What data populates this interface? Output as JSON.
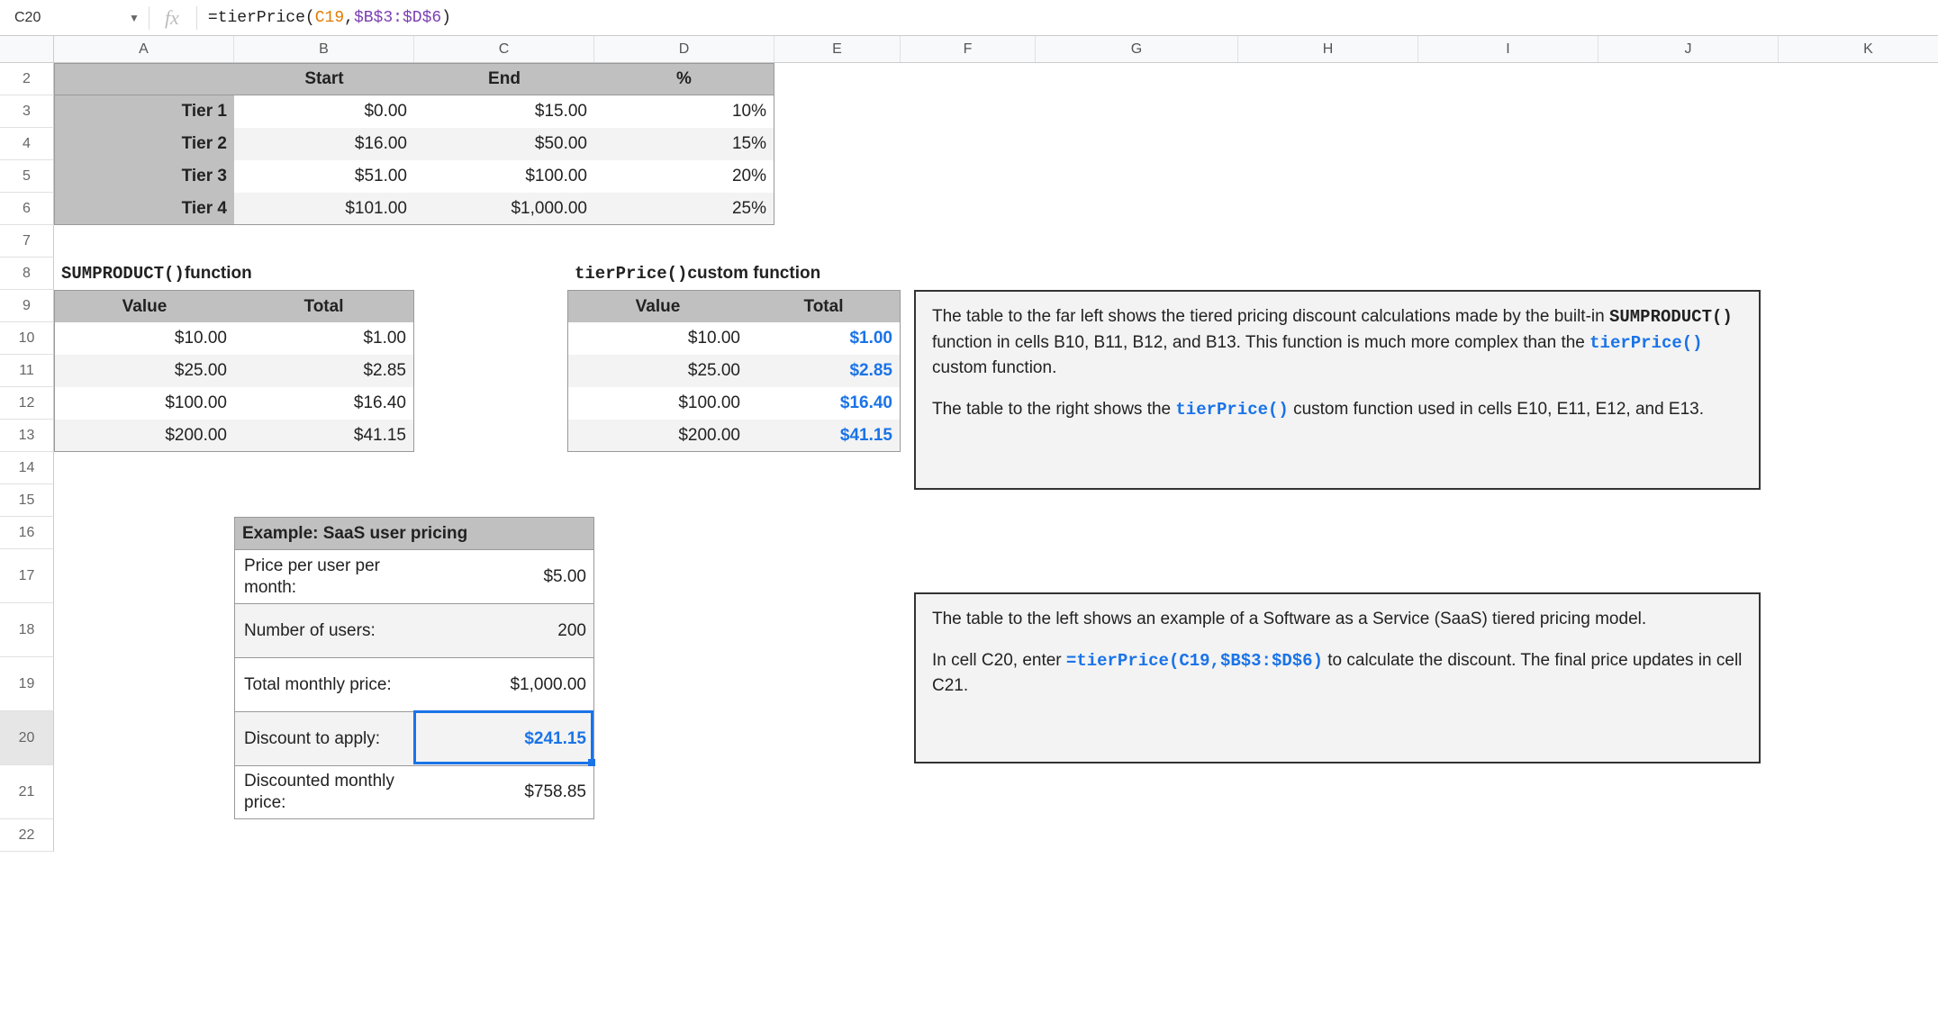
{
  "formula_bar": {
    "cell_ref": "C20",
    "fn": "=tierPrice",
    "arg1": "C19",
    "arg2": "$B$3:$D$6"
  },
  "columns": {
    "A": "A",
    "B": "B",
    "C": "C",
    "D": "D",
    "E": "E",
    "F": "F",
    "G": "G",
    "H": "H",
    "I": "I",
    "J": "J",
    "K": "K"
  },
  "rows": [
    "2",
    "3",
    "4",
    "5",
    "6",
    "7",
    "8",
    "9",
    "10",
    "11",
    "12",
    "13",
    "14",
    "15",
    "16",
    "17",
    "18",
    "19",
    "20",
    "21",
    "22"
  ],
  "tier_table": {
    "headers": {
      "start": "Start",
      "end": "End",
      "pct": "%"
    },
    "rows": [
      {
        "name": "Tier 1",
        "start": "$0.00",
        "end": "$15.00",
        "pct": "10%"
      },
      {
        "name": "Tier 2",
        "start": "$16.00",
        "end": "$50.00",
        "pct": "15%"
      },
      {
        "name": "Tier 3",
        "start": "$51.00",
        "end": "$100.00",
        "pct": "20%"
      },
      {
        "name": "Tier 4",
        "start": "$101.00",
        "end": "$1,000.00",
        "pct": "25%"
      }
    ]
  },
  "sumproduct": {
    "title_code": "SUMPRODUCT()",
    "title_rest": " function",
    "hdr_value": "Value",
    "hdr_total": "Total",
    "rows": [
      {
        "value": "$10.00",
        "total": "$1.00"
      },
      {
        "value": "$25.00",
        "total": "$2.85"
      },
      {
        "value": "$100.00",
        "total": "$16.40"
      },
      {
        "value": "$200.00",
        "total": "$41.15"
      }
    ]
  },
  "tierprice": {
    "title_code": "tierPrice()",
    "title_rest": " custom function",
    "hdr_value": "Value",
    "hdr_total": "Total",
    "rows": [
      {
        "value": "$10.00",
        "total": "$1.00"
      },
      {
        "value": "$25.00",
        "total": "$2.85"
      },
      {
        "value": "$100.00",
        "total": "$16.40"
      },
      {
        "value": "$200.00",
        "total": "$41.15"
      }
    ]
  },
  "saas": {
    "title": "Example: SaaS user pricing",
    "rows": [
      {
        "label": "Price per user per month:",
        "value": "$5.00"
      },
      {
        "label": "Number of users:",
        "value": "200"
      },
      {
        "label": "Total monthly price:",
        "value": "$1,000.00"
      },
      {
        "label": "Discount to apply:",
        "value": "$241.15"
      },
      {
        "label": "Discounted monthly price:",
        "value": "$758.85"
      }
    ]
  },
  "note1": {
    "p1a": "The table to the far left shows the tiered pricing discount calculations made by the built-in ",
    "p1code": "SUMPRODUCT()",
    "p1b": " function in cells B10, B11, B12, and B13. This function is much more complex than the ",
    "p1code2": "tierPrice()",
    "p1c": " custom function.",
    "p2a": "The table to the right shows the ",
    "p2code": "tierPrice()",
    "p2b": " custom function used in cells E10, E11, E12, and E13."
  },
  "note2": {
    "p1": "The table to the left shows an example of a Software as a Service (SaaS) tiered pricing model.",
    "p2a": "In cell C20, enter ",
    "p2code": "=tierPrice(C19,$B$3:$D$6)",
    "p2b": " to calculate the discount. The final price updates in cell C21."
  }
}
